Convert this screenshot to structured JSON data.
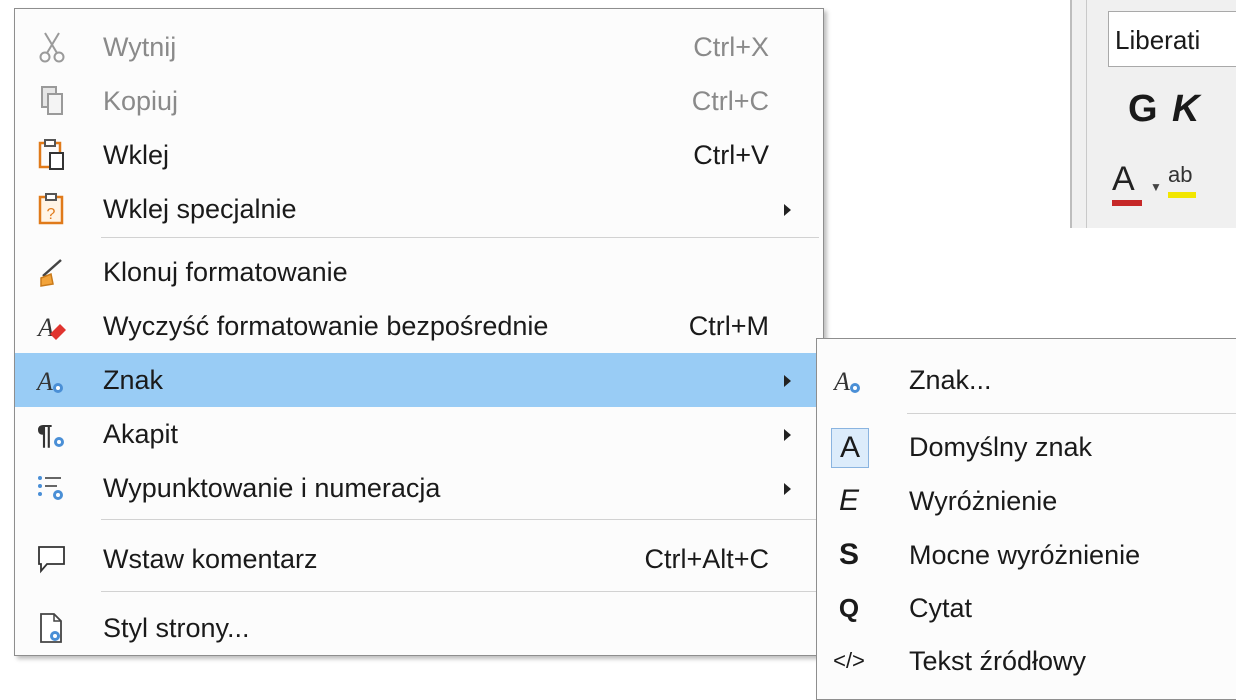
{
  "toolbar": {
    "font_name": "Liberati",
    "bold_label": "G",
    "italic_label": "K",
    "font_color_label": "A",
    "highlight_label": "ab"
  },
  "menu": {
    "items": [
      {
        "label": "Wytnij",
        "shortcut": "Ctrl+X",
        "icon": "scissors-icon",
        "enabled": false
      },
      {
        "label": "Kopiuj",
        "shortcut": "Ctrl+C",
        "icon": "copy-icon",
        "enabled": false
      },
      {
        "label": "Wklej",
        "shortcut": "Ctrl+V",
        "icon": "paste-icon",
        "enabled": true
      },
      {
        "label": "Wklej specjalnie",
        "shortcut": "",
        "icon": "paste-special-icon",
        "enabled": true,
        "submenu": true
      },
      {
        "label": "Klonuj formatowanie",
        "shortcut": "",
        "icon": "clone-formatting-icon",
        "enabled": true
      },
      {
        "label": "Wyczyść formatowanie bezpośrednie",
        "shortcut": "Ctrl+M",
        "icon": "clear-formatting-icon",
        "enabled": true
      },
      {
        "label": "Znak",
        "shortcut": "",
        "icon": "character-icon",
        "enabled": true,
        "submenu": true,
        "highlighted": true
      },
      {
        "label": "Akapit",
        "shortcut": "",
        "icon": "paragraph-icon",
        "enabled": true,
        "submenu": true
      },
      {
        "label": "Wypunktowanie i numeracja",
        "shortcut": "",
        "icon": "bullets-numbering-icon",
        "enabled": true,
        "submenu": true
      },
      {
        "label": "Wstaw komentarz",
        "shortcut": "Ctrl+Alt+C",
        "icon": "comment-icon",
        "enabled": true
      },
      {
        "label": "Styl strony...",
        "shortcut": "",
        "icon": "page-style-icon",
        "enabled": true
      }
    ]
  },
  "submenu": {
    "items": [
      {
        "label": "Znak...",
        "icon": "character-dialog-icon"
      },
      {
        "label": "Domyślny znak",
        "icon": "A"
      },
      {
        "label": "Wyróżnienie",
        "icon": "E"
      },
      {
        "label": "Mocne wyróżnienie",
        "icon": "S"
      },
      {
        "label": "Cytat",
        "icon": "Q"
      },
      {
        "label": "Tekst źródłowy",
        "icon": "</>"
      }
    ]
  },
  "colors": {
    "highlight": "#99ccf5",
    "font_color_bar": "#c62828",
    "highlight_bar": "#f2e600",
    "disabled_text": "#8a8a8a"
  }
}
